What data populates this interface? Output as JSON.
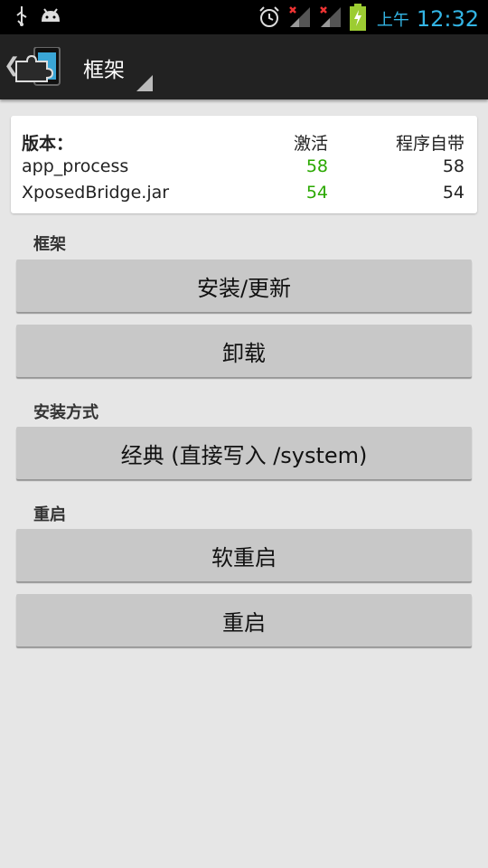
{
  "status_bar": {
    "icons_left": [
      "usb-icon",
      "android-debug-icon"
    ],
    "icons_right": [
      "alarm-icon",
      "signal-icon",
      "signal-icon",
      "battery-charging-icon"
    ],
    "ampm": "上午",
    "time": "12:32",
    "colors": {
      "time": "#33b5e5",
      "battery": "#9ccc32"
    }
  },
  "action_bar": {
    "title": "框架",
    "icons": [
      "back-chevron-icon",
      "xposed-puzzle-logo-icon",
      "spinner-triangle-icon"
    ]
  },
  "versions": {
    "header": {
      "label": "版本：",
      "active": "激活",
      "bundled": "程序自带"
    },
    "rows": [
      {
        "name": "app_process",
        "active": "58",
        "bundled": "58"
      },
      {
        "name": "XposedBridge.jar",
        "active": "54",
        "bundled": "54"
      }
    ],
    "active_color": "#2aa800"
  },
  "framework": {
    "title": "框架",
    "install_update": "安装/更新",
    "uninstall": "卸载"
  },
  "install_mode": {
    "title": "安装方式",
    "selected": "经典 (直接写入 /system)"
  },
  "reboot": {
    "title": "重启",
    "soft_reboot": "软重启",
    "reboot": "重启"
  }
}
